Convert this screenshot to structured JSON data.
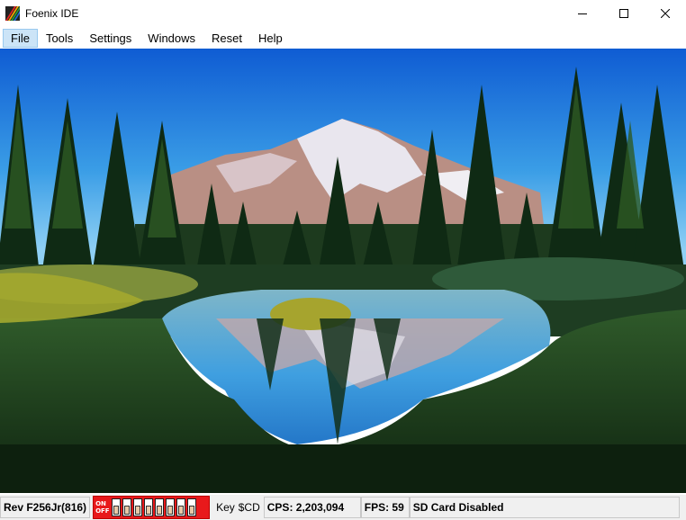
{
  "window": {
    "title": "Foenix IDE"
  },
  "menu": {
    "items": [
      {
        "label": "File",
        "active": true
      },
      {
        "label": "Tools"
      },
      {
        "label": "Settings"
      },
      {
        "label": "Windows"
      },
      {
        "label": "Reset"
      },
      {
        "label": "Help"
      }
    ]
  },
  "display": {
    "content": "pixel-art-landscape-mountain-lake-forest"
  },
  "status": {
    "revision": "Rev F256Jr(816)",
    "dip_on": "ON",
    "dip_off": "OFF",
    "key_label": "Key",
    "key_value": "$CD",
    "cps": "CPS: 2,203,094",
    "fps": "FPS: 59",
    "sd_card": "SD Card Disabled"
  },
  "colors": {
    "dip_background": "#e8191b",
    "menu_active": "#cce4f7",
    "sky_top": "#0f62d6",
    "sky_bottom": "#7fc7f2"
  }
}
